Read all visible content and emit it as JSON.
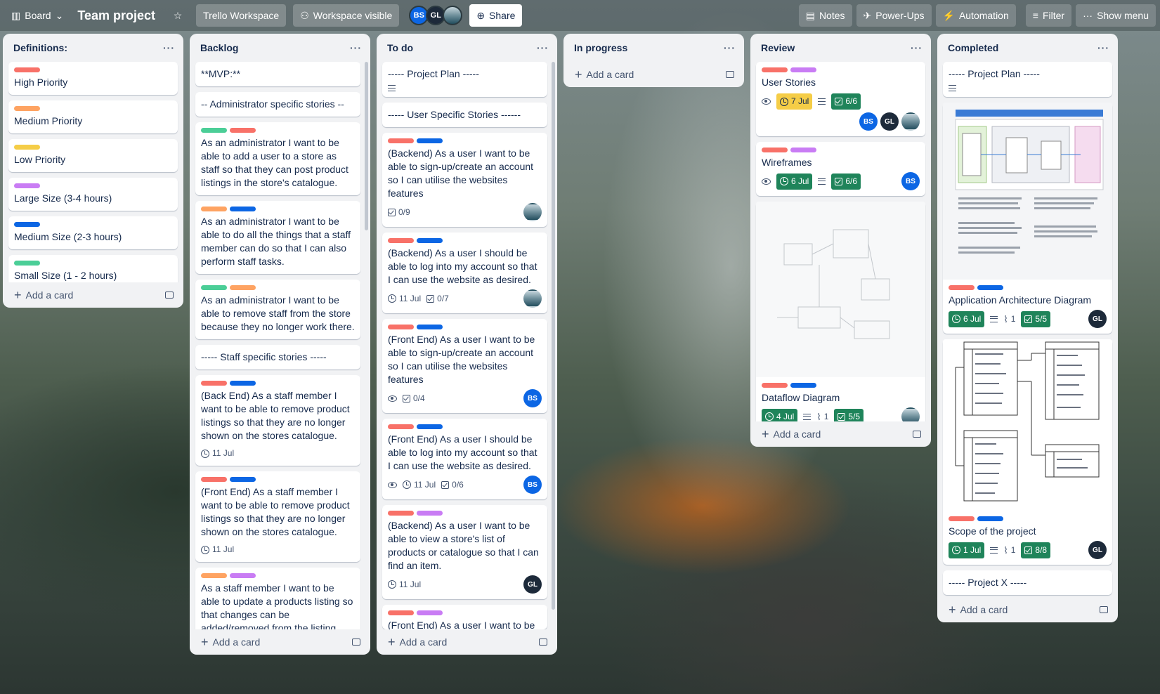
{
  "topbar": {
    "view": "Board",
    "title": "Team project",
    "workspace": "Trello Workspace",
    "visibility": "Workspace visible",
    "members": [
      "BS",
      "GL"
    ],
    "share": "Share",
    "notes": "Notes",
    "powerups": "Power-Ups",
    "automation": "Automation",
    "filter": "Filter",
    "menu": "Show menu"
  },
  "colors": {
    "red": "#f87168",
    "orange": "#fea362",
    "yellow": "#f5cd47",
    "purple": "#c97cf4",
    "blue": "#0c66e4",
    "green": "#4bce97"
  },
  "add_card": "Add a card",
  "lists": {
    "definitions": {
      "title": "Definitions:",
      "cards": [
        "High Priority",
        "Medium Priority",
        "Low Priority",
        "Large Size (3-4 hours)",
        "Medium Size (2-3 hours)",
        "Small Size (1 - 2 hours)"
      ]
    },
    "backlog": {
      "title": "Backlog",
      "cards": [
        "**MVP:**",
        "-- Administrator specific stories --",
        "As an administrator I want to be able to add a user to a store as staff so that they can post product listings in the store's catalogue.",
        "As an administrator I want to be able to do all the things that a staff member can do so that I can also perform staff tasks.",
        "As an administrator I want to be able to remove staff from the store because they no longer work there.",
        "----- Staff specific stories -----",
        "(Back End) As a staff member I want to be able to remove product listings so that they are no longer shown on the stores catalogue.",
        "(Front End) As a staff member I want to be able to remove product listings so that they are no longer shown on the stores catalogue.",
        "As a staff member I want to be able to update a products listing so that changes can be added/removed from the listing."
      ],
      "dates": [
        "11 Jul",
        "11 Jul"
      ]
    },
    "todo": {
      "title": "To do",
      "cards": [
        "----- Project Plan -----",
        "----- User Specific Stories ------",
        "(Backend) As a user I want to be able to sign-up/create an account so I can utilise the websites features",
        "(Backend) As a user I should be able to log into my account so that I can use the website as desired.",
        "(Front End) As a user I want to be able to sign-up/create an account so I can utilise the websites features",
        "(Front End) As a user I should be able to log into my account so that I can use the website as desired.",
        "(Backend) As a user I want to be able to view a store's list of products or catalogue so that I can find an item.",
        "(Front End) As a user I want to be able to view a store's list of"
      ],
      "checklists": [
        "0/9",
        "0/7",
        "0/4",
        "0/6"
      ],
      "dates": [
        "11 Jul",
        "11 Jul",
        "11 Jul"
      ],
      "members": [
        "BS",
        "BS",
        "GL"
      ]
    },
    "inprogress": {
      "title": "In progress"
    },
    "review": {
      "title": "Review",
      "cards": [
        "User Stories",
        "Wireframes",
        "Dataflow Diagram"
      ],
      "dates": [
        "7 Jul",
        "6 Jul",
        "4 Jul"
      ],
      "checklists": [
        "6/6",
        "6/6",
        "5/5"
      ],
      "attachments": [
        "1"
      ],
      "members": [
        "BS",
        "GL",
        "BS"
      ]
    },
    "completed": {
      "title": "Completed",
      "cards": [
        "----- Project Plan -----",
        "Application Architecture Diagram",
        "Scope of the project",
        "----- Project X -----"
      ],
      "dates": [
        "6 Jul",
        "1 Jul"
      ],
      "checklists": [
        "5/5",
        "8/8"
      ],
      "attachments": [
        "1",
        "1"
      ],
      "members": [
        "GL",
        "GL"
      ]
    }
  }
}
